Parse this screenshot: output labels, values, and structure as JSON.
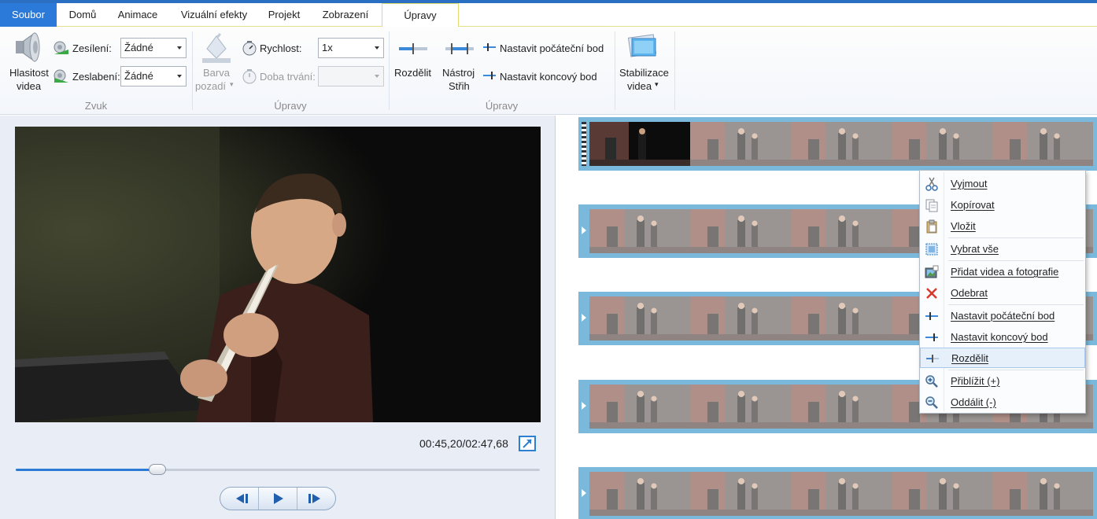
{
  "tabs": [
    {
      "label": "Soubor",
      "key": "file"
    },
    {
      "label": "Domů",
      "key": "home"
    },
    {
      "label": "Animace",
      "key": "animations"
    },
    {
      "label": "Vizuální efekty",
      "key": "visual"
    },
    {
      "label": "Projekt",
      "key": "project"
    },
    {
      "label": "Zobrazení",
      "key": "view"
    },
    {
      "label": "Úpravy",
      "key": "edit"
    }
  ],
  "ribbon": {
    "audio": {
      "volume_label_1": "Hlasitost",
      "volume_label_2": "videa",
      "fade_in_label": "Zesílení:",
      "fade_in_value": "Žádné",
      "fade_out_label": "Zeslabení:",
      "fade_out_value": "Žádné",
      "group_label": "Zvuk"
    },
    "edit": {
      "bg_color_label_1": "Barva",
      "bg_color_label_2": "pozadí",
      "speed_label": "Rychlost:",
      "speed_value": "1x",
      "duration_label": "Doba trvání:",
      "duration_value": "",
      "group_label": "Úpravy"
    },
    "edit2": {
      "split_label": "Rozdělit",
      "trim_label_1": "Nástroj",
      "trim_label_2": "Střih",
      "set_start_label": "Nastavit počáteční bod",
      "set_end_label": "Nastavit koncový bod",
      "group_label": "Úpravy"
    },
    "stabilize": {
      "label_1": "Stabilizace",
      "label_2": "videa"
    }
  },
  "preview": {
    "timecode": "00:45,20/02:47,68",
    "progress": 0.27
  },
  "context_menu": {
    "items": [
      {
        "label": "Vyjmout",
        "icon": "scissors-icon"
      },
      {
        "label": "Kopírovat",
        "icon": "copy-icon"
      },
      {
        "label": "Vložit",
        "icon": "paste-icon"
      },
      {
        "label": "Vybrat vše",
        "icon": "select-all-icon"
      },
      {
        "label": "Přidat videa a fotografie",
        "icon": "add-media-icon"
      },
      {
        "label": "Odebrat",
        "icon": "remove-icon"
      },
      {
        "label": "Nastavit počáteční bod",
        "icon": "set-start-icon"
      },
      {
        "label": "Nastavit koncový bod",
        "icon": "set-end-icon"
      },
      {
        "label": "Rozdělit",
        "icon": "split-icon"
      },
      {
        "label": "Přiblížit (+)",
        "icon": "zoom-in-icon"
      },
      {
        "label": "Oddálit (-)",
        "icon": "zoom-out-icon"
      }
    ]
  },
  "colors": {
    "accent": "#2b79d8",
    "active_tab_border": "#e2dc72",
    "storyboard_strip": "#7ab8dc"
  }
}
